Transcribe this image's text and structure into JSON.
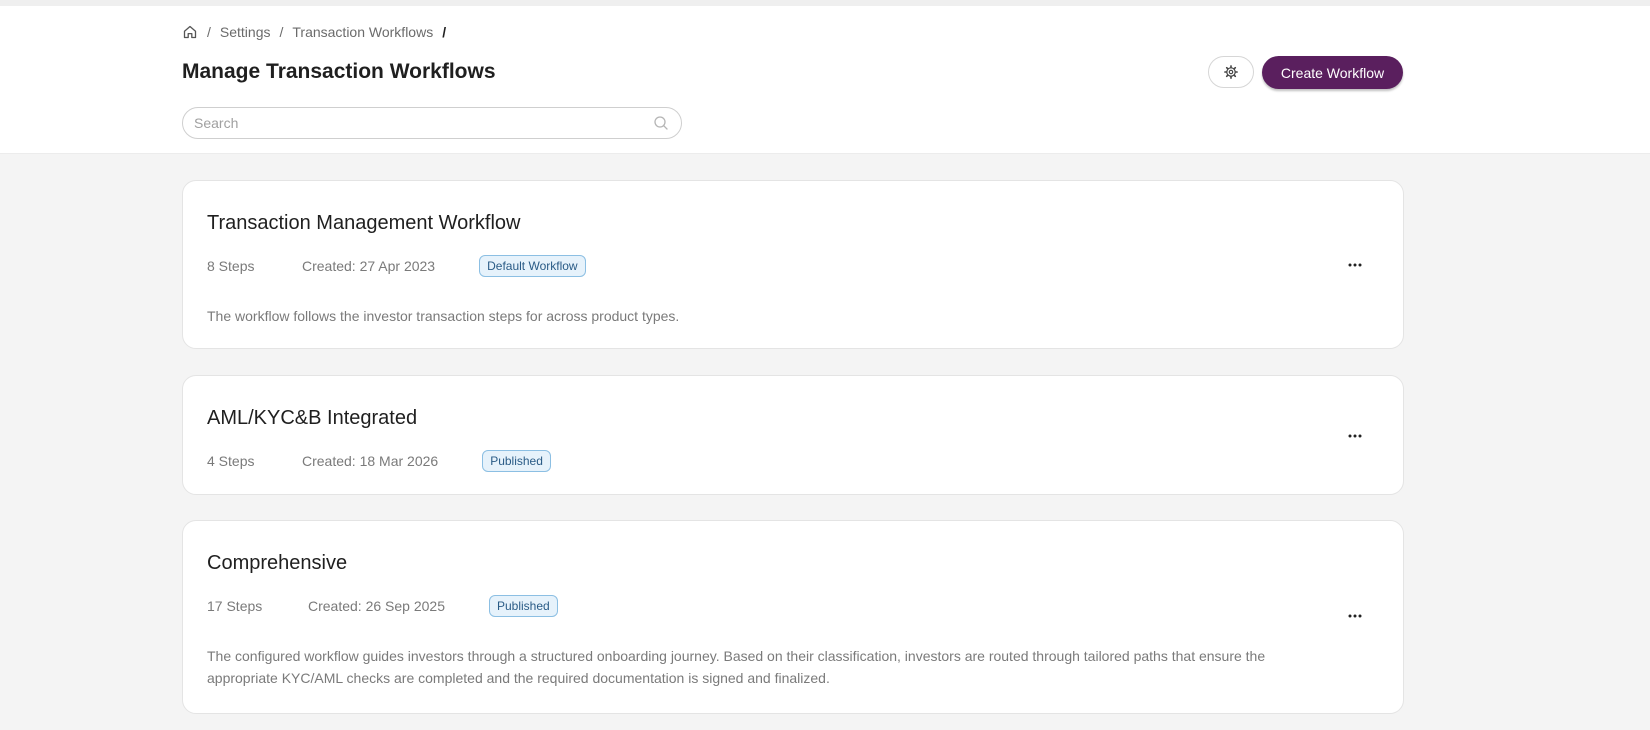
{
  "breadcrumb": {
    "home_icon": "home-icon",
    "items": [
      "Settings",
      "Transaction Workflows"
    ],
    "separator": "/"
  },
  "page": {
    "title": "Manage Transaction Workflows"
  },
  "toolbar": {
    "settings_icon": "gear-icon",
    "create_label": "Create Workflow",
    "accent_color": "#5a1f5e"
  },
  "search": {
    "placeholder": "Search",
    "value": "",
    "icon": "search-icon"
  },
  "workflows": [
    {
      "title": "Transaction Management Workflow",
      "steps": "8 Steps",
      "created": "Created: 27 Apr 2023",
      "badge": "Default Workflow",
      "description": "The workflow follows the investor transaction steps for across product types."
    },
    {
      "title": "AML/KYC&B Integrated",
      "steps": "4 Steps",
      "created": "Created: 18 Mar 2026",
      "badge": "Published",
      "description": ""
    },
    {
      "title": "Comprehensive",
      "steps": "17 Steps",
      "created": "Created: 26 Sep 2025",
      "badge": "Published",
      "description": "The configured workflow guides investors through a structured onboarding journey. Based on their classification, investors are routed through tailored paths that ensure the appropriate KYC/AML checks are completed and the required documentation is signed and finalized."
    }
  ],
  "card_menu_icon": "more-horizontal-icon"
}
